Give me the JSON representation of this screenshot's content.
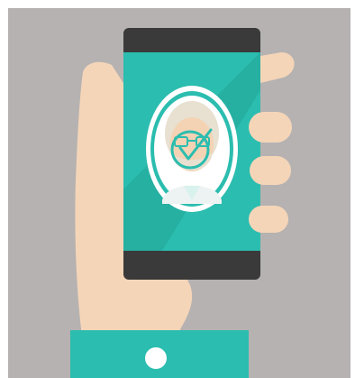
{
  "scene": {
    "description_icon": "hand-holding-smartphone-face-verification-illustration",
    "colors": {
      "background": "#B5B2B1",
      "frame": "#FFFFFF",
      "skin": "#F5D5B8",
      "sleeve": "#2BBDAF",
      "cuff_button": "#FFFFFF",
      "phone_body": "#3A3A3A",
      "screen": "#2BBDAF",
      "screen_shade": "#20A597",
      "badge_ring": "#FFFFFF",
      "face_hair": "#E8E0D0",
      "face_skin": "#F3D3B4",
      "glasses": "#2BBDAF",
      "shirt": "#D9F2EE",
      "check": "#2BBDAF"
    },
    "icons": {
      "hand": "hand-icon",
      "phone": "smartphone-icon",
      "avatar": "person-avatar-icon",
      "check": "checkmark-circle-icon"
    }
  }
}
